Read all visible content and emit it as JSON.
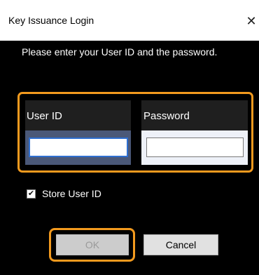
{
  "window": {
    "title": "Key Issuance Login",
    "close_glyph": "✕"
  },
  "prompt": {
    "text": "Please enter your User ID and the password."
  },
  "credentials": {
    "user_id": {
      "label": "User ID",
      "value": ""
    },
    "password": {
      "label": "Password",
      "value": ""
    }
  },
  "store_user_id": {
    "label": "Store User ID",
    "checked": true,
    "check_glyph": "✔"
  },
  "buttons": {
    "ok": {
      "label": "OK",
      "enabled": false
    },
    "cancel": {
      "label": "Cancel",
      "enabled": true
    }
  },
  "colors": {
    "highlight": "#f39a1e",
    "background": "#000000",
    "focus_border": "#2f6fd0"
  },
  "icons": {
    "close": "close-icon",
    "check": "check-icon"
  }
}
